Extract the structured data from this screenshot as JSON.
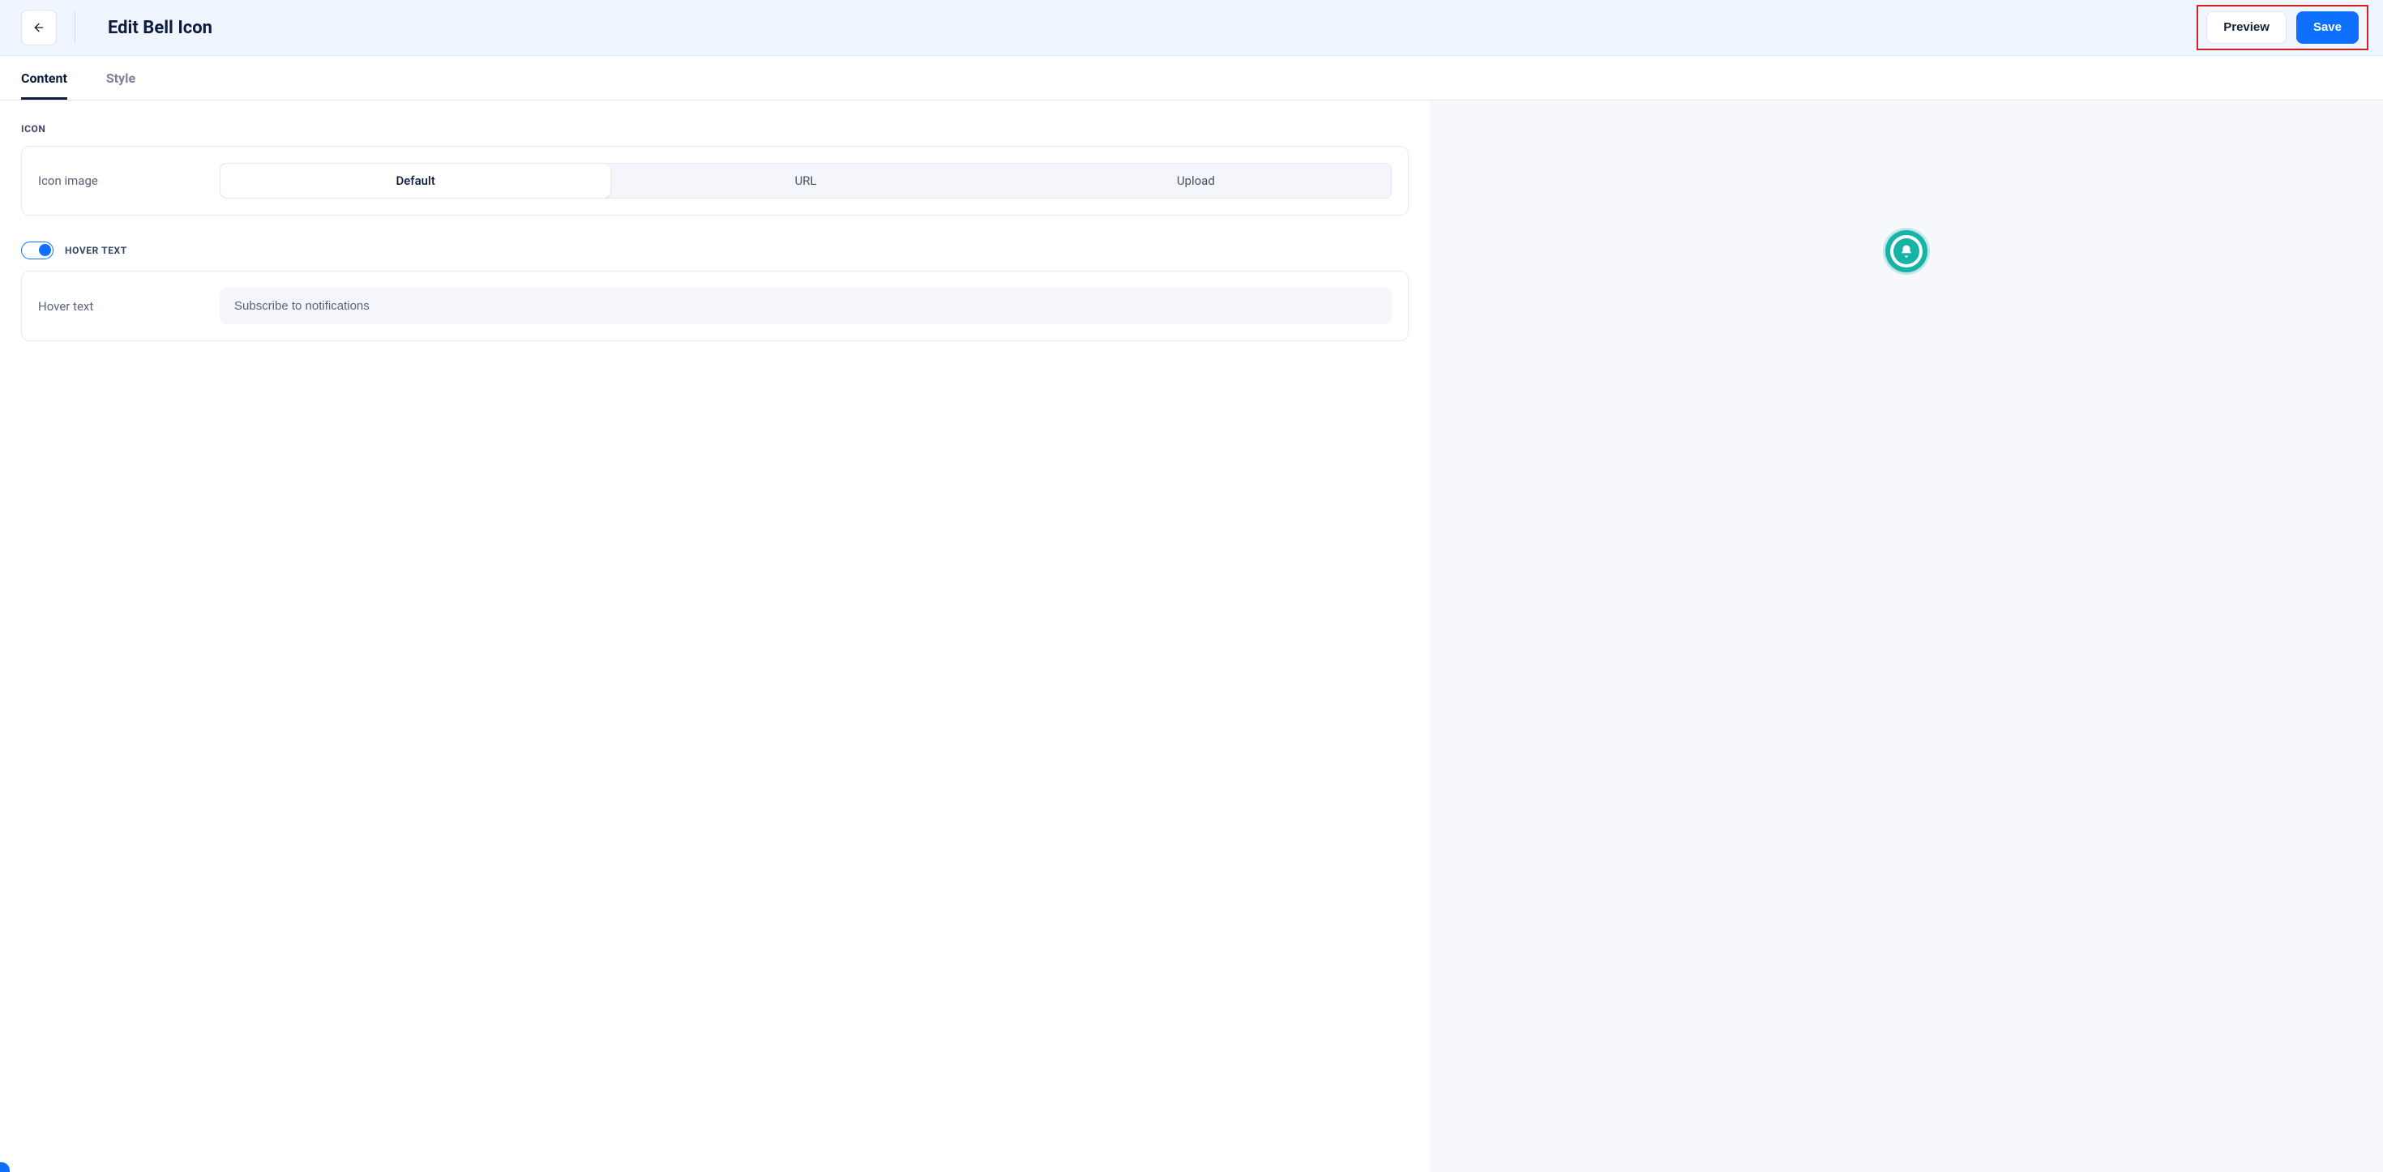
{
  "header": {
    "title": "Edit Bell Icon",
    "preview_label": "Preview",
    "save_label": "Save"
  },
  "tabs": {
    "content": "Content",
    "style": "Style",
    "active": "content"
  },
  "icon_section": {
    "header": "ICON",
    "field_label": "Icon image",
    "options": {
      "default": "Default",
      "url": "URL",
      "upload": "Upload"
    },
    "selected": "default"
  },
  "hover_section": {
    "header": "HOVER TEXT",
    "enabled": true,
    "field_label": "Hover text",
    "value": "Subscribe to notifications"
  },
  "colors": {
    "accent": "#0f6fff",
    "teal": "#17b3a7",
    "highlight": "#d22121"
  }
}
